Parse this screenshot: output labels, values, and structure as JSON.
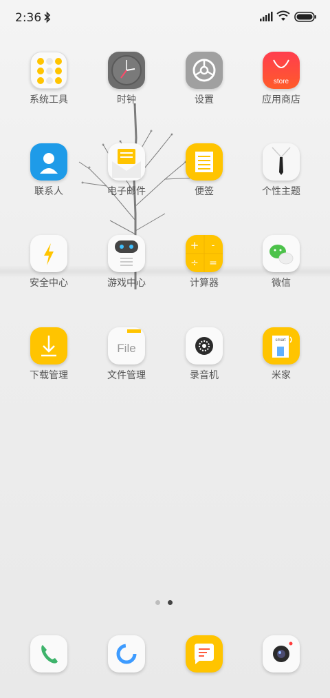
{
  "status_bar": {
    "time": "2:36"
  },
  "apps": [
    {
      "label": "系统工具"
    },
    {
      "label": "时钟"
    },
    {
      "label": "设置"
    },
    {
      "label": "应用商店",
      "icon_text": "store"
    },
    {
      "label": "联系人"
    },
    {
      "label": "电子邮件"
    },
    {
      "label": "便签"
    },
    {
      "label": "个性主题"
    },
    {
      "label": "安全中心"
    },
    {
      "label": "游戏中心"
    },
    {
      "label": "计算器"
    },
    {
      "label": "微信"
    },
    {
      "label": "下载管理"
    },
    {
      "label": "文件管理",
      "icon_text": "File"
    },
    {
      "label": "录音机"
    },
    {
      "label": "米家",
      "icon_text": "smart"
    }
  ],
  "page_indicator": {
    "pages": 2,
    "current": 2
  },
  "dock": [
    {
      "icon": "phone-icon"
    },
    {
      "icon": "browser-icon"
    },
    {
      "icon": "messages-icon"
    },
    {
      "icon": "camera-icon"
    }
  ],
  "colors": {
    "accent_yellow": "#FFC400",
    "store_red": "#FF3B3B",
    "contacts_blue": "#1E9BE8"
  }
}
